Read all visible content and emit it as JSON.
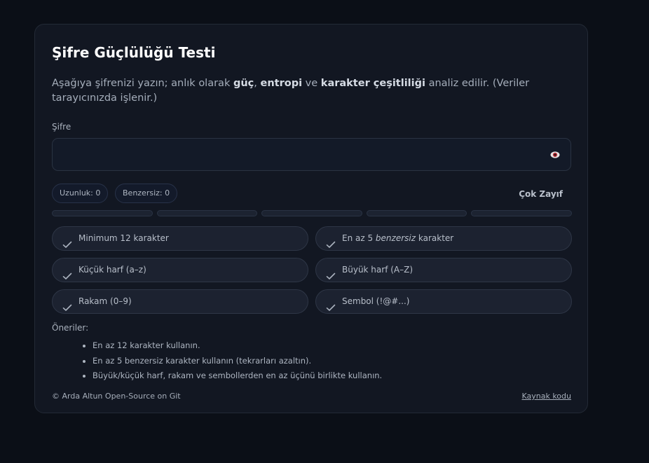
{
  "card": {
    "title": "Şifre Güçlülüğü Testi",
    "description": {
      "part1": "Aşağıya şifrenizi yazın; anlık olarak ",
      "bold1": "güç",
      "part2": ", ",
      "bold2": "entropi",
      "part3": " ve ",
      "bold3": "karakter çeşitliliği",
      "part4": " analiz edilir. (Veriler tarayıcınızda işlenir.)"
    },
    "password_label": "Şifre",
    "password_value": "",
    "password_placeholder": ""
  },
  "stats": {
    "length_label": "Uzunluk: 0",
    "unique_label": "Benzersiz: 0",
    "strength_label": "Çok Zayıf"
  },
  "strength_meter": {
    "segments": 5,
    "filled": 0
  },
  "checks": {
    "min_length": "Minimum 12 karakter",
    "unique_pre": "En az 5 ",
    "unique_em": "benzersiz",
    "unique_post": " karakter",
    "lowercase": "Küçük harf (a–z)",
    "uppercase": "Büyük harf (A–Z)",
    "digit": "Rakam (0–9)",
    "symbol": "Sembol (!@#...)"
  },
  "suggestions": {
    "title": "Öneriler:",
    "items": [
      "En az 12 karakter kullanın.",
      "En az 5 benzersiz karakter kullanın (tekrarları azaltın).",
      "Büyük/küçük harf, rakam ve sembollerden en az üçünü birlikte kullanın."
    ]
  },
  "footer": {
    "copyright": "© Arda Altun Open-Source on Git",
    "source_link": "Kaynak kodu"
  },
  "icons": {
    "eye": "eye-icon",
    "check": "check-icon"
  },
  "colors": {
    "background": "#0b0f17",
    "card": "#121722",
    "text_strong": "#ffffff"
  }
}
